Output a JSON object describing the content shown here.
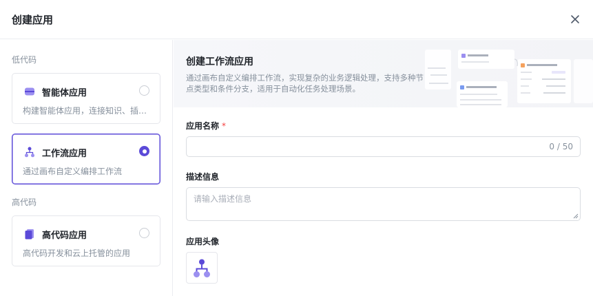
{
  "dialog": {
    "title": "创建应用",
    "close_icon": "close-icon"
  },
  "sidebar": {
    "groups": [
      {
        "label": "低代码",
        "items": [
          {
            "name": "智能体应用",
            "desc": "构建智能体应用，连接知识、插件…",
            "icon": "agent-icon",
            "selected": false
          },
          {
            "name": "工作流应用",
            "desc": "通过画布自定义编排工作流",
            "icon": "workflow-icon",
            "selected": true
          }
        ]
      },
      {
        "label": "高代码",
        "items": [
          {
            "name": "高代码应用",
            "desc": "高代码开发和云上托管的应用",
            "icon": "code-file-icon",
            "selected": false
          }
        ]
      }
    ]
  },
  "banner": {
    "title": "创建工作流应用",
    "desc": "通过画布自定义编排工作流，实现复杂的业务逻辑处理，支持多种节点类型和条件分支，适用于自动化任务处理场景。"
  },
  "form": {
    "name_label": "应用名称",
    "required_mark": "*",
    "name_value": "",
    "name_counter": "0 / 50",
    "desc_label": "描述信息",
    "desc_placeholder": "请输入描述信息",
    "avatar_label": "应用头像",
    "avatar_icon": "workflow-icon"
  },
  "colors": {
    "accent": "#5b4ad8",
    "icon_light": "#9b8ff0",
    "required": "#f53f3f"
  }
}
